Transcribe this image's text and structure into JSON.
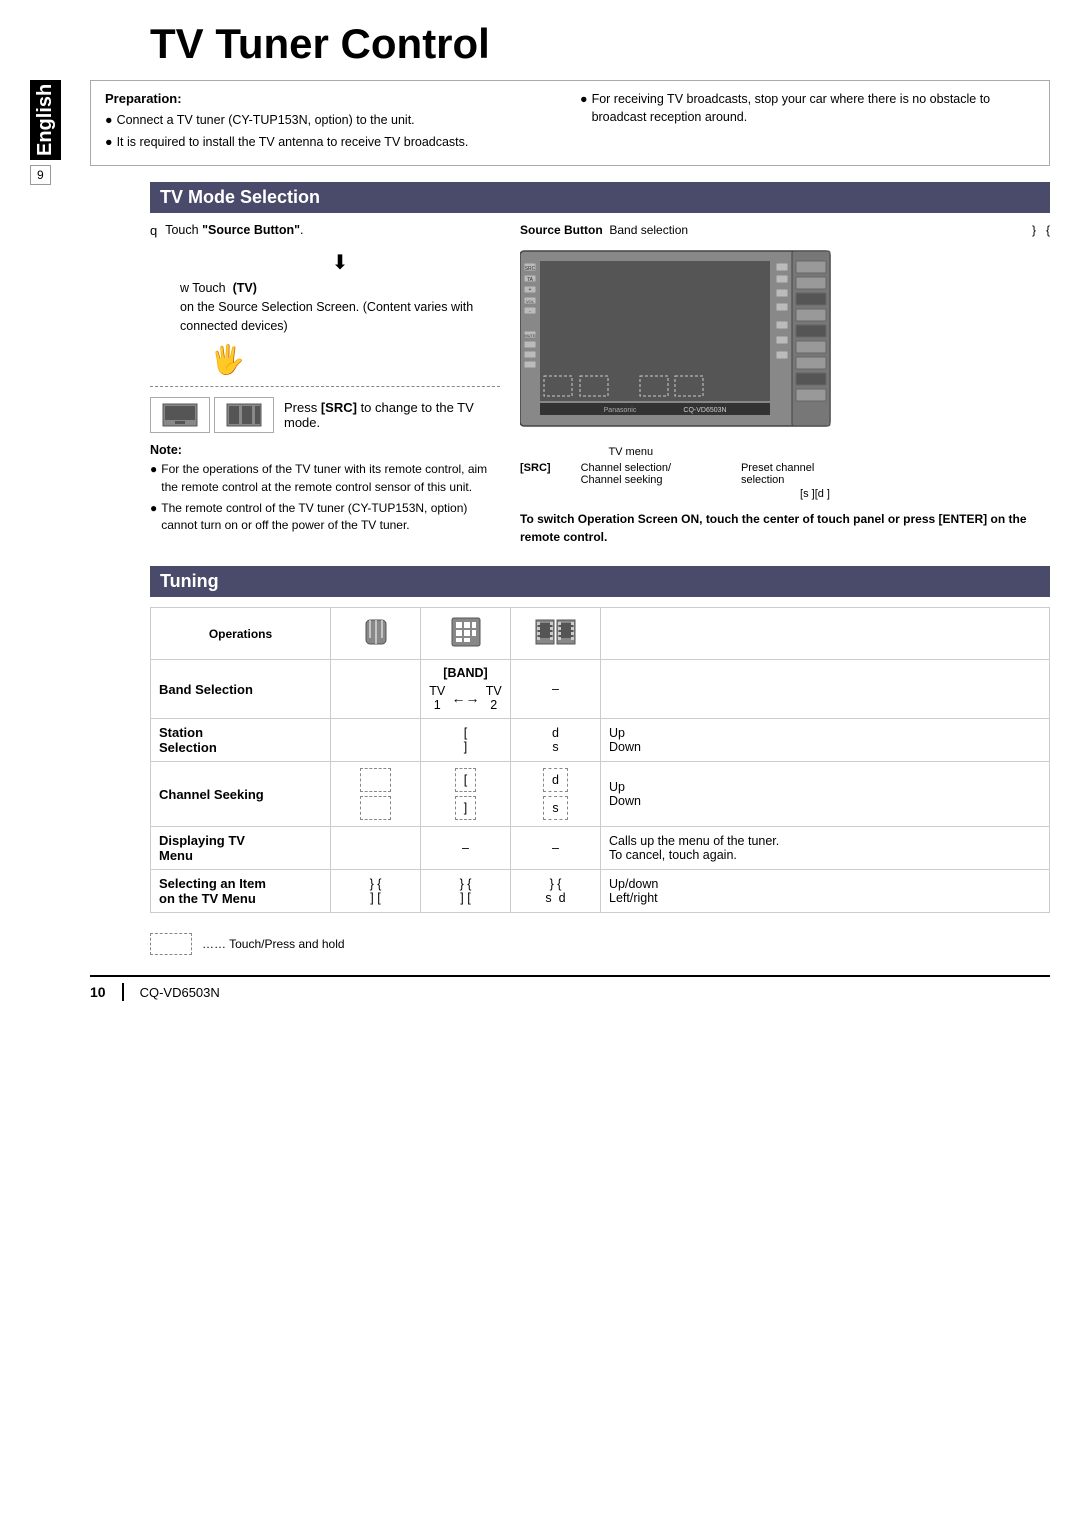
{
  "title": "TV Tuner Control",
  "side_label": "English",
  "page_number": "9",
  "preparation": {
    "title": "Preparation:",
    "left_bullets": [
      "Connect a TV tuner (CY-TUP153N, option) to the unit.",
      "It is required to install the TV antenna to receive TV broadcasts."
    ],
    "right_bullets": [
      "For receiving TV broadcasts, stop your car where there is no obstacle to broadcast reception around."
    ]
  },
  "tv_mode": {
    "header": "TV Mode Selection",
    "step1": {
      "num": "q",
      "text": "Touch “Source Button”."
    },
    "step2": {
      "num": "w",
      "text": "Touch",
      "bold": "(TV)",
      "sub": "on the Source Selection Screen. (Content varies with connected devices)"
    },
    "press_src": "Press [SRC] to change to the TV mode.",
    "note_title": "Note:",
    "notes": [
      "For the operations of the TV tuner with its remote control, aim the remote control at the remote control sensor of this unit.",
      "The remote control of the TV tuner (CY-TUP153N, option) cannot turn on or off the power of the TV tuner."
    ],
    "source_button_label": "Source Button",
    "band_selection_label": "Band selection",
    "tv_menu_label": "TV menu",
    "src_label": "[SRC]",
    "channel_selection_label": "Channel selection/ Channel seeking",
    "preset_channel_label": "Preset channel selection",
    "brackets_label": "[s ][d ]",
    "switch_note": "To switch Operation Screen ON, touch the center of touch panel or press [ENTER] on the remote control."
  },
  "tuning": {
    "header": "Tuning",
    "ops_label": "Operations",
    "columns": [
      "",
      "",
      ""
    ],
    "rows": [
      {
        "label": "Band Selection",
        "bold": true,
        "col2": "[BAND]",
        "col3": "–",
        "col4": "",
        "result": "",
        "sub": {
          "col2_sub": "TV 1",
          "arrow": "←→",
          "col3_sub": "TV 2"
        }
      },
      {
        "label": "Station\nSelection",
        "bold": true,
        "col2": "[",
        "col3": "d",
        "col4": "Up",
        "col2b": "]",
        "col3b": "s",
        "col4b": "Down"
      },
      {
        "label": "Channel Seeking",
        "bold": true,
        "dashed": true,
        "col2": "[ ]",
        "col3": "d s",
        "col4": "Up\nDown",
        "dashed_boxes": true
      },
      {
        "label": "Displaying TV\nMenu",
        "bold": true,
        "dashed": true,
        "col2": "–",
        "col3": "–",
        "col4": "Calls up the menu of the tuner.\nTo cancel, touch again."
      },
      {
        "label": "Selecting an Item\non the TV Menu",
        "bold": true,
        "dashed": true,
        "col2": "} {",
        "col3": "} {",
        "col4": "Up/down",
        "col2b": "] [",
        "col3b": "s  d",
        "col4b": "Left/right"
      }
    ]
  },
  "footer": {
    "dashed_box_label": "",
    "dots_label": "…… Touch/Press and hold",
    "page_num": "10",
    "model": "CQ-VD6503N"
  }
}
